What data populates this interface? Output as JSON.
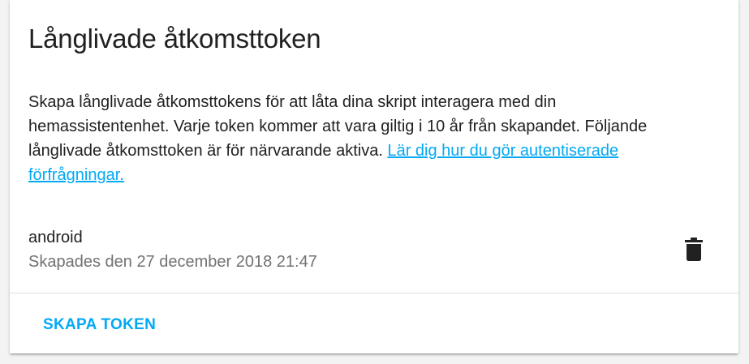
{
  "card": {
    "title": "Långlivade åtkomsttoken",
    "description": "Skapa långlivade åtkomsttokens för att låta dina skript interagera med din hemassistentenhet. Varje token kommer att vara giltig i 10 år från skapandet. Följande långlivade åtkomsttoken är för närvarande aktiva.",
    "link_text": "Lär dig hur du gör autentiserade förfrågningar."
  },
  "tokens": [
    {
      "name": "android",
      "created": "Skapades den 27 december 2018 21:47",
      "delete_icon": "trash-icon"
    }
  ],
  "actions": {
    "create_label": "SKAPA TOKEN"
  },
  "colors": {
    "accent": "#03a9f4",
    "primary_text": "#212121",
    "secondary_text": "#727272"
  }
}
